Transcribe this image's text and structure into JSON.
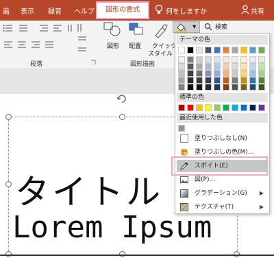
{
  "tabs": {
    "design": "画",
    "view": "表示",
    "recording": "録音",
    "help": "ヘルプ",
    "shape_format": "図形の書式",
    "tell_me": "何をしますか",
    "share": "共有"
  },
  "ribbon": {
    "search_label": "検索",
    "shape_button": "図形",
    "arrange_button": "配置",
    "quick_style_line1": "クイック",
    "quick_style_line2": "スタイル",
    "group_paragraph": "段落",
    "group_drawing": "図形描画"
  },
  "slide": {
    "title": "タイトル",
    "body": "Lorem Ipsum"
  },
  "fill_menu": {
    "theme_colors_header": "テーマの色",
    "standard_colors_header": "標準の色",
    "recent_colors_header": "最近使用した色",
    "items": [
      {
        "label": "塗りつぶしなし(N)",
        "icon": "no-fill-icon",
        "submenu": false
      },
      {
        "label": "塗りつぶしの色(M)...",
        "icon": "color-palette-icon",
        "submenu": false
      },
      {
        "label": "スポイト(E)",
        "icon": "eyedropper-icon",
        "submenu": false,
        "highlighted": true
      },
      {
        "label": "図(P)...",
        "icon": "picture-icon",
        "submenu": false
      },
      {
        "label": "グラデーション(G)",
        "icon": "gradient-icon",
        "submenu": true
      },
      {
        "label": "テクスチャ(T)",
        "icon": "texture-icon",
        "submenu": true
      }
    ],
    "theme_top_row": [
      "#ffffff",
      "#000000",
      "#e7e6e6",
      "#44546a",
      "#4472c4",
      "#ed7d31",
      "#a5a5a5",
      "#ffc000",
      "#5b9bd5",
      "#70ad47"
    ],
    "theme_shades": [
      [
        "#f2f2f2",
        "#7f7f7f",
        "#d0cece",
        "#d6dce4",
        "#dae3f3",
        "#fbe5d6",
        "#ededed",
        "#fff2cc",
        "#deebf7",
        "#e2f0d9"
      ],
      [
        "#d9d9d9",
        "#595959",
        "#aeabab",
        "#adb9ca",
        "#b4c7e7",
        "#f8cbad",
        "#dbdbdb",
        "#ffe699",
        "#bdd7ee",
        "#c5e0b4"
      ],
      [
        "#bfbfbf",
        "#404040",
        "#757171",
        "#8497b0",
        "#8faadc",
        "#f4b183",
        "#c9c9c9",
        "#ffd966",
        "#9dc3e6",
        "#a9d18e"
      ],
      [
        "#a6a6a6",
        "#262626",
        "#3a3838",
        "#333f50",
        "#2f5597",
        "#c55a11",
        "#7b7b7b",
        "#bf9000",
        "#2e75b6",
        "#538135"
      ],
      [
        "#7f7f7f",
        "#0d0d0d",
        "#171616",
        "#222a35",
        "#203864",
        "#843c0c",
        "#525252",
        "#7f6000",
        "#1f4e79",
        "#385723"
      ]
    ],
    "standard_colors": [
      "#c00000",
      "#ff0000",
      "#ffc000",
      "#ffff00",
      "#92d050",
      "#00b050",
      "#00b0f0",
      "#0070c0",
      "#002060",
      "#7030a0"
    ],
    "recent_colors": [
      "#8497b0"
    ]
  },
  "colors": {
    "ribbon_accent": "#b7472a",
    "highlight_outline": "#f4a9c0"
  }
}
